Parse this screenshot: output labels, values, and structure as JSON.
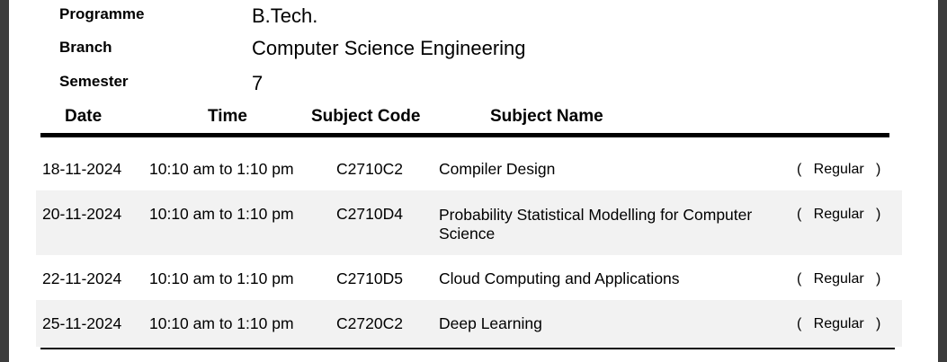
{
  "info": {
    "programme_label": "Programme",
    "programme_value": "B.Tech.",
    "branch_label": "Branch",
    "branch_value": "Computer Science Engineering",
    "semester_label": "Semester",
    "semester_value": "7"
  },
  "table": {
    "headers": [
      "Date",
      "Time",
      "Subject Code",
      "Subject Name"
    ],
    "rows": [
      {
        "date": "18-11-2024",
        "time": "10:10 am to 1:10 pm",
        "code": "C2710C2",
        "name": "Compiler Design",
        "type": "(   Regular   )"
      },
      {
        "date": "20-11-2024",
        "time": "10:10 am to 1:10 pm",
        "code": "C2710D4",
        "name": "Probability Statistical Modelling for Computer Science",
        "type": "(   Regular   )"
      },
      {
        "date": "22-11-2024",
        "time": "10:10 am to 1:10 pm",
        "code": "C2710D5",
        "name": "Cloud Computing and Applications",
        "type": "(   Regular   )"
      },
      {
        "date": "25-11-2024",
        "time": "10:10 am to 1:10 pm",
        "code": "C2720C2",
        "name": "Deep Learning",
        "type": "(   Regular   )"
      }
    ]
  }
}
